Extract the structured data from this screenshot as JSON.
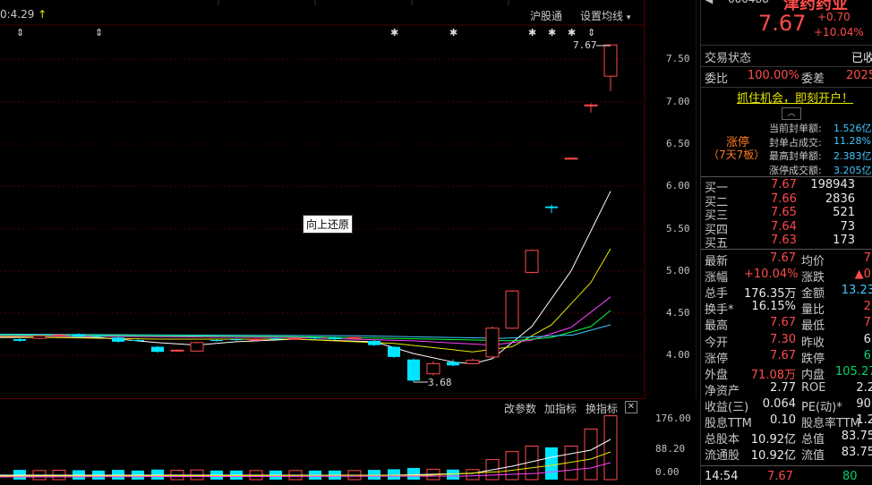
{
  "header": {
    "value_text": "0:4.29",
    "arrow": "↑",
    "hgt_label": "沪股通",
    "settings_label": "设置均线",
    "settings_caret": "▾"
  },
  "tooltip": "向上还原",
  "price_axis": [
    "7.50",
    "7.00",
    "6.50",
    "6.00",
    "5.50",
    "5.00",
    "4.50",
    "4.00"
  ],
  "volume_axis": [
    "176.00",
    "88.20",
    "0.00"
  ],
  "markers": {
    "high_label": "7.67",
    "low_label": "3.68"
  },
  "toolbar": {
    "params": "改参数",
    "add": "加指标",
    "switch": "换指标",
    "close": "✕"
  },
  "side": {
    "code": "600488",
    "name": "津药药业",
    "price": "7.67",
    "change": "+0.70",
    "change_pct": "+10.04%",
    "trade_status_label": "交易状态",
    "trade_status_value": "已收",
    "weibi_label": "委比",
    "weibi_value": "100.00%",
    "weicha_label": "委差",
    "weicha_value": "2025",
    "promo": "抓住机会，即刻开户！",
    "limit_tag": "涨停",
    "limit_sub": "（7天7板）",
    "limit_info": [
      {
        "label": "当前封单额:",
        "value": "1.526亿"
      },
      {
        "label": "封单占成交:",
        "value": "11.28%"
      },
      {
        "label": "最高封单额:",
        "value": "2.383亿"
      },
      {
        "label": "涨停成交额:",
        "value": "3.205亿"
      }
    ],
    "bids": [
      {
        "label": "买一",
        "price": "7.67",
        "vol": "198943"
      },
      {
        "label": "买二",
        "price": "7.66",
        "vol": "2836"
      },
      {
        "label": "买三",
        "price": "7.65",
        "vol": "521"
      },
      {
        "label": "买四",
        "price": "7.64",
        "vol": "73"
      },
      {
        "label": "买五",
        "price": "7.63",
        "vol": "173"
      }
    ],
    "stats": [
      {
        "l1": "最新",
        "v1": "7.67",
        "c1": "red",
        "l2": "均价",
        "v2": "7.",
        "c2": "red"
      },
      {
        "l1": "涨幅",
        "v1": "+10.04%",
        "c1": "red",
        "l2": "涨跌",
        "v2": "▲0.",
        "c2": "red"
      },
      {
        "l1": "总手",
        "v1": "176.35万",
        "c1": "white",
        "l2": "金额",
        "v2": "13.23",
        "c2": "cyan"
      },
      {
        "l1": "换手*",
        "v1": "16.15%",
        "c1": "white",
        "l2": "量比",
        "v2": "2.",
        "c2": "red"
      },
      {
        "l1": "最高",
        "v1": "7.67",
        "c1": "red",
        "l2": "最低",
        "v2": "7.",
        "c2": "red"
      },
      {
        "l1": "今开",
        "v1": "7.30",
        "c1": "red",
        "l2": "昨收",
        "v2": "6.",
        "c2": "white"
      },
      {
        "l1": "涨停",
        "v1": "7.67",
        "c1": "red",
        "l2": "跌停",
        "v2": "6.",
        "c2": "green"
      },
      {
        "l1": "外盘",
        "v1": "71.08万",
        "c1": "red",
        "l2": "内盘",
        "v2": "105.27",
        "c2": "green"
      },
      {
        "l1": "净资产",
        "v1": "2.77",
        "c1": "white",
        "l2": "ROE",
        "v2": "2.2",
        "c2": "white"
      },
      {
        "l1": "收益(三)",
        "v1": "0.064",
        "c1": "white",
        "l2": "PE(动)*",
        "v2": "90.",
        "c2": "white"
      },
      {
        "l1": "股息TTM",
        "v1": "0.10",
        "c1": "white",
        "l2": "股息率TTM",
        "v2": "1.2",
        "c2": "white"
      },
      {
        "l1": "总股本",
        "v1": "10.92亿",
        "c1": "white",
        "l2": "总值",
        "v2": "83.75",
        "c2": "white"
      },
      {
        "l1": "流通股",
        "v1": "10.92亿",
        "c1": "white",
        "l2": "流值",
        "v2": "83.75",
        "c2": "white"
      }
    ],
    "tick": {
      "time": "14:54",
      "price": "7.67",
      "vol": "80"
    }
  },
  "colors": {
    "up": "#ff4a4a",
    "down": "#00e5ff",
    "ma5": "#ffffff",
    "ma10": "#e8e800",
    "ma20": "#ff40ff",
    "ma30": "#00ff40"
  }
}
